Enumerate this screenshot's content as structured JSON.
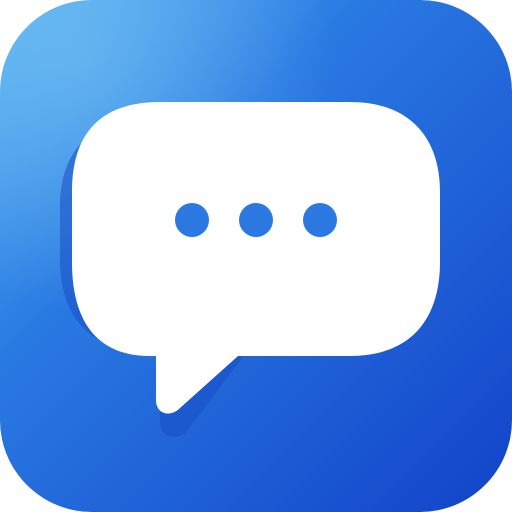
{
  "icon": {
    "name": "chat-app-icon",
    "glyph": "speech-bubble-with-ellipsis",
    "colors": {
      "background_light": "#5ab4f0",
      "background_mid": "#2a7ae3",
      "background_dark": "#1243c8",
      "bubble": "#ffffff",
      "dots": "#2a78e0",
      "shadow": "#1a4fc4"
    },
    "dots_count": 3
  }
}
